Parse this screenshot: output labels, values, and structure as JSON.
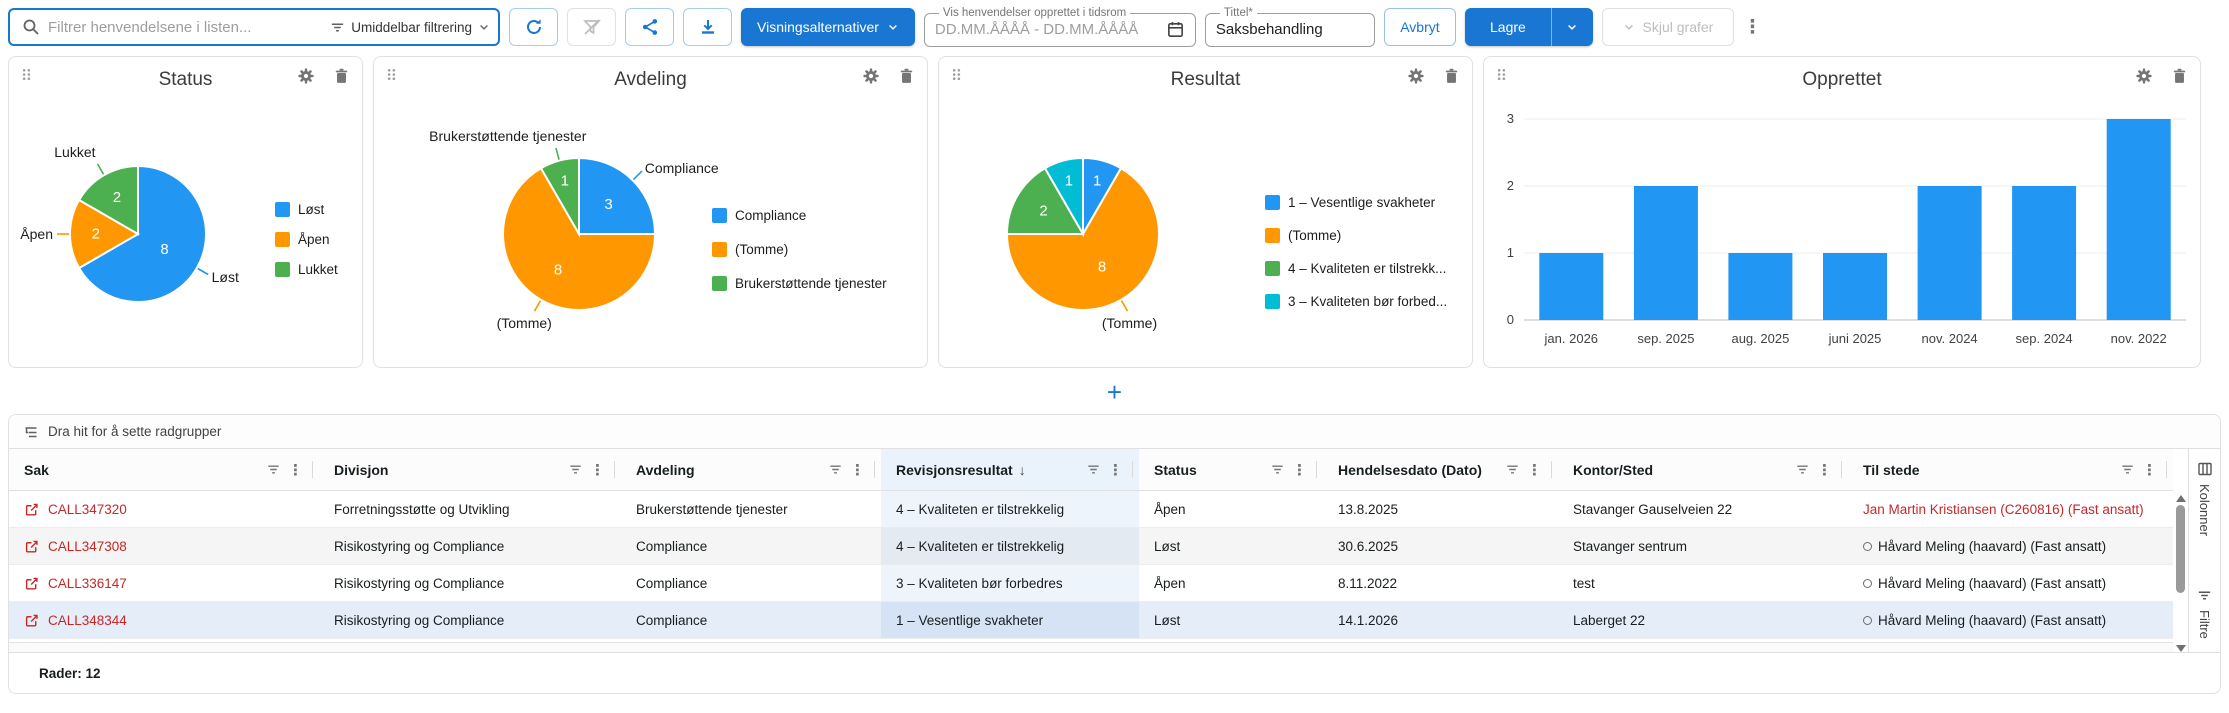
{
  "toolbar": {
    "search": {
      "placeholder": "Filtrer henvendelsene i listen..."
    },
    "filter_mode": {
      "label": "Umiddelbar filtrering"
    },
    "visningsalternativer_label": "Visningsalternativer",
    "date_range": {
      "label": "Vis henvendelser opprettet i tidsrom",
      "placeholder": "DD.MM.ÅÅÅÅ - DD.MM.ÅÅÅÅ"
    },
    "tittel": {
      "label": "Tittel*",
      "value": "Saksbehandling"
    },
    "avbryt_label": "Avbryt",
    "lagre_label": "Lagre",
    "skjul_grafer_label": "Skjul grafer"
  },
  "add_chart_label": "+",
  "chart_data": [
    {
      "type": "pie",
      "title": "Status",
      "labels": [
        "Løst",
        "Åpen",
        "Lukket"
      ],
      "legend_labels": [
        "Løst",
        "Åpen",
        "Lukket"
      ],
      "values": [
        8,
        2,
        2
      ],
      "colors": [
        "#2196f3",
        "#ff9800",
        "#4caf50"
      ],
      "legend_position": "right"
    },
    {
      "type": "pie",
      "title": "Avdeling",
      "labels": [
        "Compliance",
        "(Tomme)",
        "Brukerstøttende tjenester"
      ],
      "legend_labels": [
        "Compliance",
        "(Tomme)",
        "Brukerstøttende tjenester"
      ],
      "values": [
        3,
        8,
        1
      ],
      "colors": [
        "#2196f3",
        "#ff9800",
        "#4caf50"
      ],
      "legend_position": "right"
    },
    {
      "type": "pie",
      "title": "Resultat",
      "labels": [
        "1 – Vesentlige svakheter",
        "(Tomme)",
        "4 – Kvaliteten er tilstrekkelig",
        "3 – Kvaliteten bør forbedres"
      ],
      "legend_labels": [
        "1 – Vesentlige svakheter",
        "(Tomme)",
        "4 – Kvaliteten er tilstrekk...",
        "3 – Kvaliteten bør forbed..."
      ],
      "values": [
        1,
        8,
        2,
        1
      ],
      "colors": [
        "#2196f3",
        "#ff9800",
        "#4caf50",
        "#00bcd4"
      ],
      "legend_position": "right"
    },
    {
      "type": "bar",
      "title": "Opprettet",
      "categories": [
        "jan. 2026",
        "sep. 2025",
        "aug. 2025",
        "juni 2025",
        "nov. 2024",
        "sep. 2024",
        "nov. 2022"
      ],
      "values": [
        1,
        2,
        1,
        1,
        2,
        2,
        3
      ],
      "bar_color": "#2196f3",
      "ylim": [
        0,
        3
      ],
      "yticks": [
        0,
        1,
        2,
        3
      ],
      "grid": true,
      "legend_position": "none"
    }
  ],
  "table": {
    "group_hint": "Dra hit for å sette radgrupper",
    "columns": [
      {
        "label": "Sak"
      },
      {
        "label": "Divisjon"
      },
      {
        "label": "Avdeling"
      },
      {
        "label": "Revisjonsresultat",
        "sorted": "desc"
      },
      {
        "label": "Status"
      },
      {
        "label": "Hendelsesdato (Dato)"
      },
      {
        "label": "Kontor/Sted"
      },
      {
        "label": "Til stede"
      }
    ],
    "rows": [
      {
        "sak": "CALL347320",
        "divisjon": "Forretningsstøtte og Utvikling",
        "avdeling": "Brukerstøttende tjenester",
        "resultat": "4 – Kvaliteten er tilstrekkelig",
        "status": "Åpen",
        "dato": "13.8.2025",
        "kontor": "Stavanger Gauselveien 22",
        "tilstede": "Jan Martin Kristiansen (C260816) (Fast ansatt)",
        "tilstede_style": "red"
      },
      {
        "sak": "CALL347308",
        "divisjon": "Risikostyring og Compliance",
        "avdeling": "Compliance",
        "resultat": "4 – Kvaliteten er tilstrekkelig",
        "status": "Løst",
        "dato": "30.6.2025",
        "kontor": "Stavanger sentrum",
        "tilstede": "Håvard Meling (haavard) (Fast ansatt)",
        "tilstede_style": "presence"
      },
      {
        "sak": "CALL336147",
        "divisjon": "Risikostyring og Compliance",
        "avdeling": "Compliance",
        "resultat": "3 – Kvaliteten bør forbedres",
        "status": "Åpen",
        "dato": "8.11.2022",
        "kontor": "test",
        "tilstede": "Håvard Meling (haavard) (Fast ansatt)",
        "tilstede_style": "presence"
      },
      {
        "sak": "CALL348344",
        "divisjon": "Risikostyring og Compliance",
        "avdeling": "Compliance",
        "resultat": "1 – Vesentlige svakheter",
        "status": "Løst",
        "dato": "14.1.2026",
        "kontor": "Laberget 22",
        "tilstede": "Håvard Meling (haavard) (Fast ansatt)",
        "tilstede_style": "presence",
        "selected": true
      }
    ],
    "footer": "Rader: 12",
    "side_tabs": [
      {
        "label": "Kolonner"
      },
      {
        "label": "Filtre"
      }
    ]
  }
}
